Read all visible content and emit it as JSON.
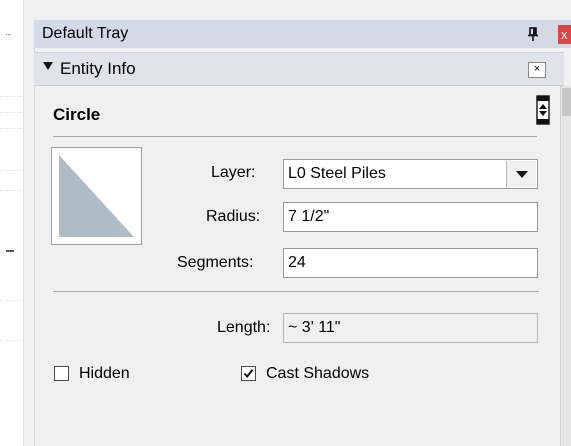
{
  "tray": {
    "title": "Default Tray",
    "close_glyph": "x"
  },
  "panel": {
    "title": "Entity Info",
    "close_glyph": "×"
  },
  "entity": {
    "type": "Circle",
    "layer_label": "Layer:",
    "layer_value": "L0 Steel Piles",
    "radius_label": "Radius:",
    "radius_value": "7 1/2\"",
    "segments_label": "Segments:",
    "segments_value": "24",
    "length_label": "Length:",
    "length_value": "~ 3' 11\""
  },
  "options": {
    "hidden_label": "Hidden",
    "hidden_checked": false,
    "cast_shadows_label": "Cast Shadows",
    "cast_shadows_checked": true
  },
  "colors": {
    "header_bg": "#d4dae5",
    "panel_header_bg": "#dfe3ea",
    "material_swatch": "#aebcc7",
    "close_red": "#e04343"
  },
  "icons": {
    "expand": "arrow-down-icon",
    "pin": "pin-icon",
    "toggle_details": "toggle-details-icon",
    "dropdown": "chevron-down-icon",
    "check": "checkmark-icon"
  }
}
